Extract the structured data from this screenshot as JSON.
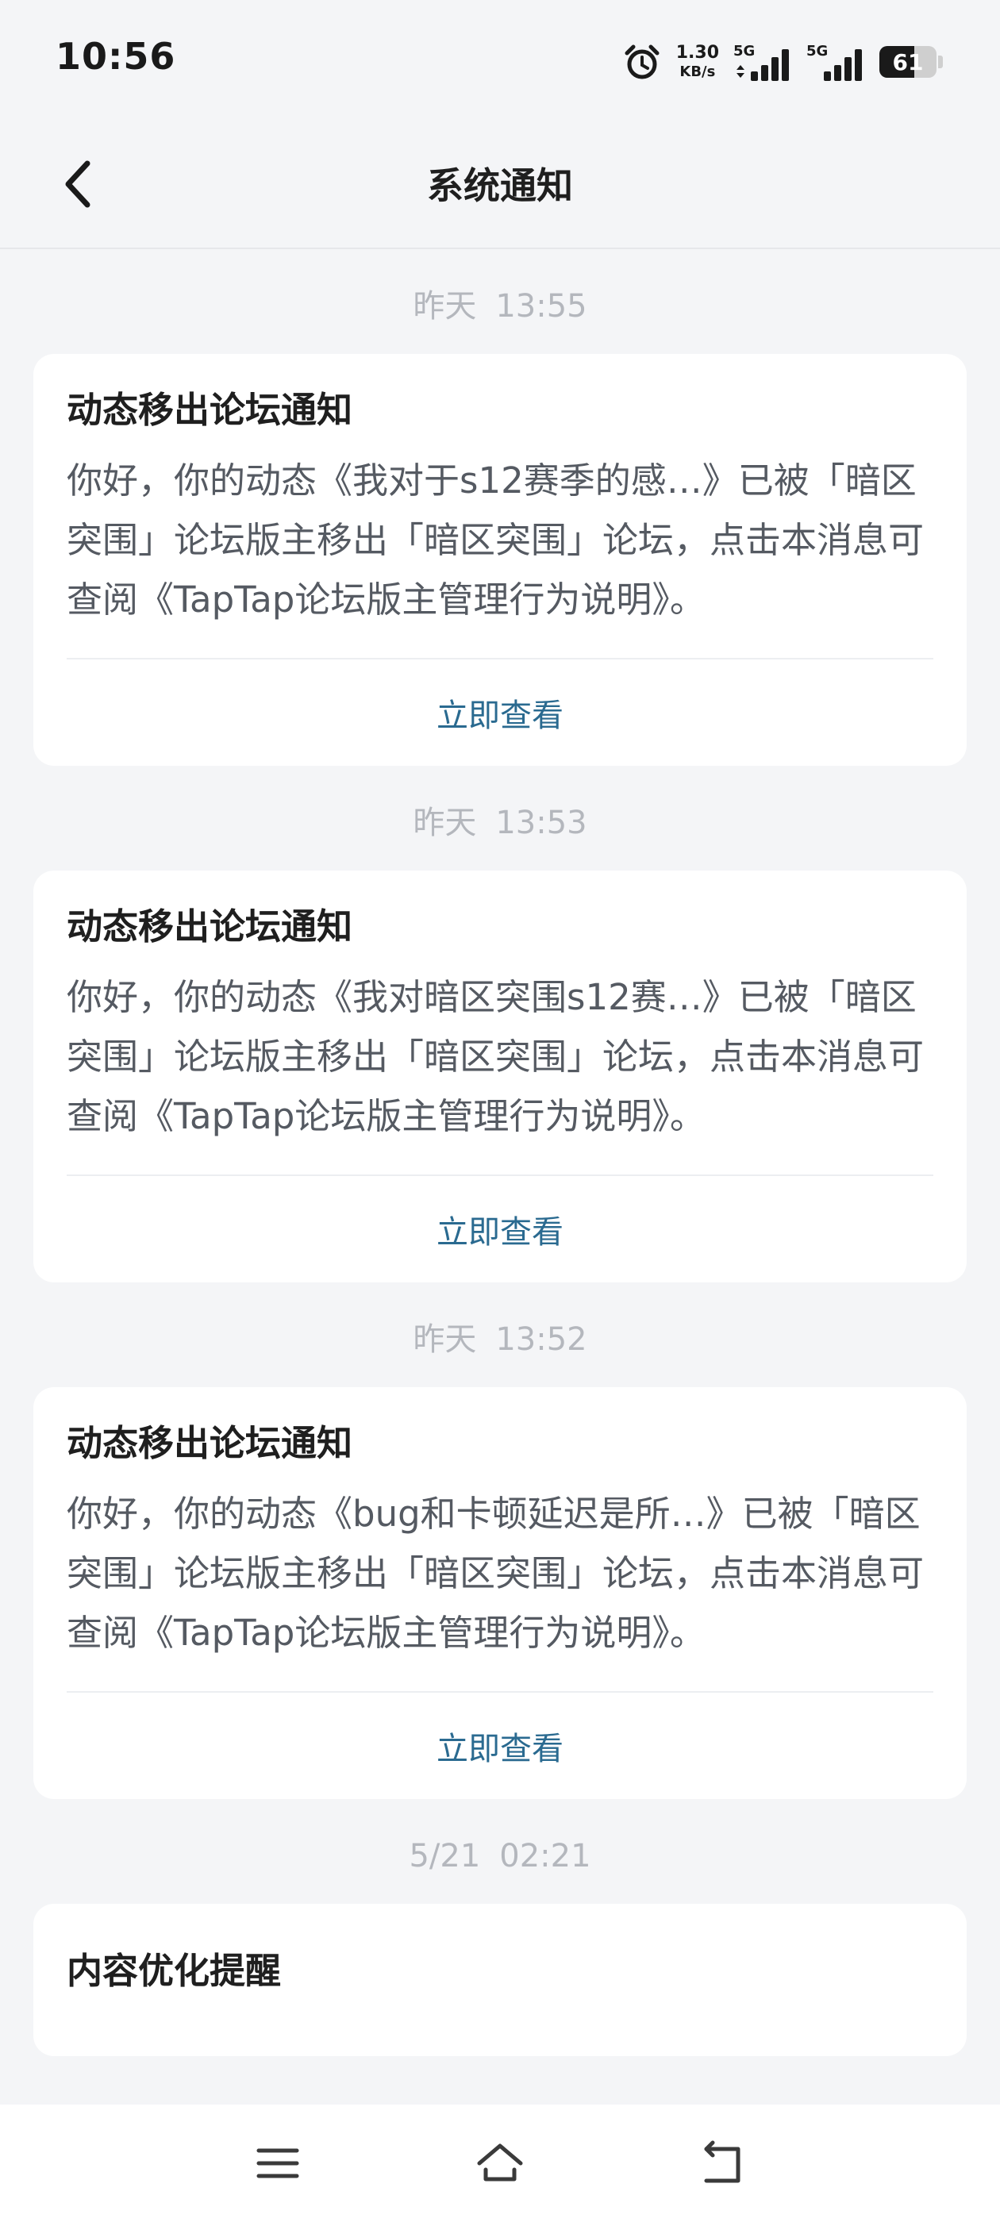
{
  "status_bar": {
    "time": "10:56",
    "net_speed_value": "1.30",
    "net_speed_unit": "KB/s",
    "signal_1_label": "5G",
    "signal_2_label": "5G",
    "battery_level": "61"
  },
  "header": {
    "title": "系统通知"
  },
  "notifications": [
    {
      "date": "昨天",
      "time": "13:55",
      "title": "动态移出论坛通知",
      "body": "你好，你的动态《我对于s12赛季的感…》已被「暗区突围」论坛版主移出「暗区突围」论坛，点击本消息可查阅《TapTap论坛版主管理行为说明》。",
      "action": "立即查看"
    },
    {
      "date": "昨天",
      "time": "13:53",
      "title": "动态移出论坛通知",
      "body": "你好，你的动态《我对暗区突围s12赛…》已被「暗区突围」论坛版主移出「暗区突围」论坛，点击本消息可查阅《TapTap论坛版主管理行为说明》。",
      "action": "立即查看"
    },
    {
      "date": "昨天",
      "time": "13:52",
      "title": "动态移出论坛通知",
      "body": "你好，你的动态《bug和卡顿延迟是所…》已被「暗区突围」论坛版主移出「暗区突围」论坛，点击本消息可查阅《TapTap论坛版主管理行为说明》。",
      "action": "立即查看"
    },
    {
      "date": "5/21",
      "time": "02:21",
      "title": "内容优化提醒"
    }
  ]
}
